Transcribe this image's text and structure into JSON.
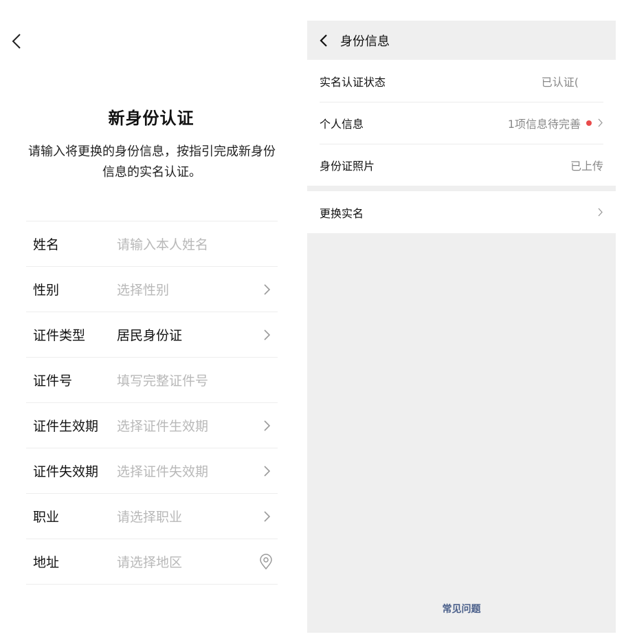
{
  "left": {
    "title": "新身份认证",
    "subtitle": "请输入将更换的身份信息，按指引完成新身份信息的实名认证。",
    "fields": [
      {
        "label": "姓名",
        "value": "请输入本人姓名",
        "filled": false,
        "icon": "none"
      },
      {
        "label": "性别",
        "value": "选择性别",
        "filled": false,
        "icon": "chevron-right-icon"
      },
      {
        "label": "证件类型",
        "value": "居民身份证",
        "filled": true,
        "icon": "chevron-right-icon"
      },
      {
        "label": "证件号",
        "value": "填写完整证件号",
        "filled": false,
        "icon": "none"
      },
      {
        "label": "证件生效期",
        "value": "选择证件生效期",
        "filled": false,
        "icon": "chevron-right-icon"
      },
      {
        "label": "证件失效期",
        "value": "选择证件失效期",
        "filled": false,
        "icon": "chevron-right-icon"
      },
      {
        "label": "职业",
        "value": "请选择职业",
        "filled": false,
        "icon": "chevron-right-icon"
      },
      {
        "label": "地址",
        "value": "请选择地区",
        "filled": false,
        "icon": "location-icon"
      }
    ]
  },
  "right": {
    "title": "身份信息",
    "rows": [
      {
        "label": "实名认证状态",
        "value": "已认证(",
        "dot": false,
        "chevron": false
      },
      {
        "label": "个人信息",
        "value": "1项信息待完善",
        "dot": true,
        "chevron": true
      },
      {
        "label": "身份证照片",
        "value": "已上传",
        "dot": false,
        "chevron": false
      }
    ],
    "change_label": "更换实名",
    "faq": "常见问题"
  },
  "colors": {
    "accent_red": "#e94b4b",
    "link_blue": "#4a5f8a",
    "placeholder": "#b8b8b8",
    "panel_bg": "#efefef"
  }
}
